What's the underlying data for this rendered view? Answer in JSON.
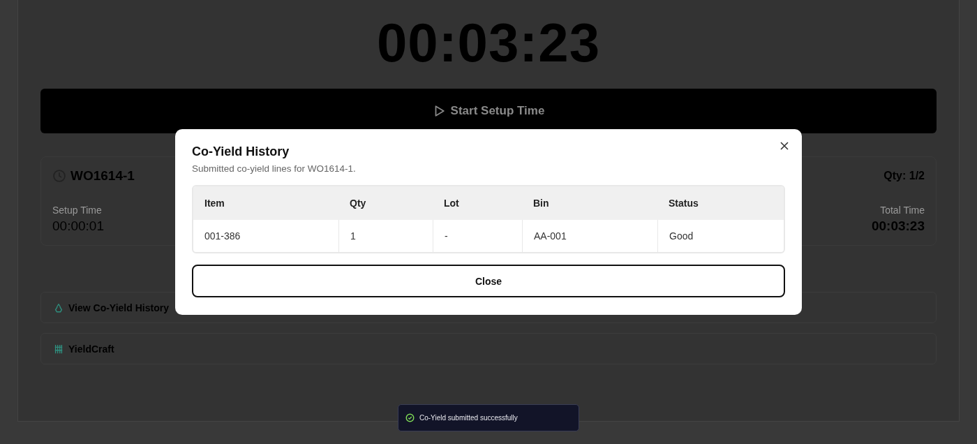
{
  "timer": "00:03:23",
  "start_button": {
    "label": "Start Setup Time"
  },
  "work_order": {
    "title": "WO1614-1",
    "qty": "Qty: 1/2",
    "setup_label": "Setup Time",
    "setup_value": "00:00:01",
    "total_label": "Total Time",
    "total_value": "00:03:23"
  },
  "actions": [
    {
      "kind": "history",
      "label": "View Co-Yield History"
    },
    {
      "kind": "app",
      "label": "YieldCraft"
    }
  ],
  "modal": {
    "title": "Co-Yield History",
    "subtitle": "Submitted co-yield lines for WO1614-1.",
    "columns": [
      "Item",
      "Qty",
      "Lot",
      "Bin",
      "Status"
    ],
    "rows": [
      [
        "001-386",
        "1",
        "-",
        "AA-001",
        "Good"
      ]
    ],
    "close_button": "Close"
  },
  "toast": {
    "message": "Co-Yield submitted successfully"
  }
}
